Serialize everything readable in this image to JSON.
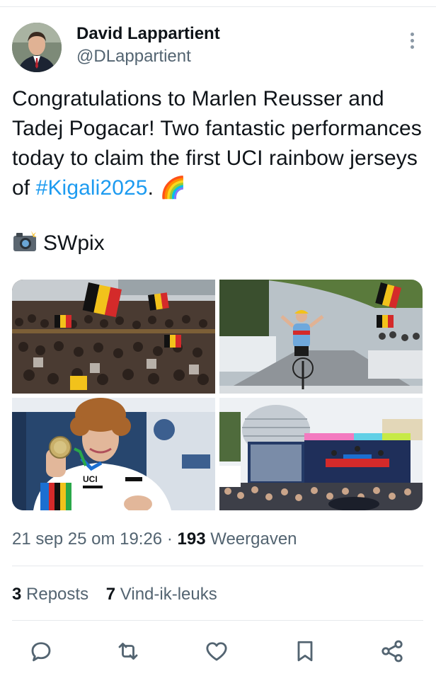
{
  "author": {
    "name": "David Lappartient",
    "handle": "@DLappartient"
  },
  "tweet": {
    "text_before_hashtag": "Congratulations to Marlen Reusser and Tadej Pogacar! Two fantastic performances today to claim the first UCI rainbow jerseys of ",
    "hashtag": "#Kigali2025",
    "text_after_hashtag": ". ",
    "rainbow_emoji": "🌈",
    "credit_text": "SWpix",
    "credit_icon": "camera-with-flash-icon"
  },
  "photos": [
    {
      "name": "crowd-with-belgian-flags"
    },
    {
      "name": "cyclist-celebrating-finish"
    },
    {
      "name": "rider-with-medal-rainbow-jersey",
      "jersey_text": "UCI"
    },
    {
      "name": "podium-stage-kigali"
    }
  ],
  "meta": {
    "timestamp": "21 sep 25 om 19:26",
    "separator": "·",
    "views_count": "193",
    "views_label": "Weergaven"
  },
  "stats": {
    "reposts_count": "3",
    "reposts_label": "Reposts",
    "likes_count": "7",
    "likes_label": "Vind-ik-leuks"
  },
  "actions": [
    "reply-icon",
    "repost-icon",
    "like-icon",
    "bookmark-icon",
    "share-icon"
  ],
  "colors": {
    "text": "#0f1419",
    "secondary": "#536471",
    "link": "#1d9bf0",
    "divider": "#e6e9ec"
  }
}
